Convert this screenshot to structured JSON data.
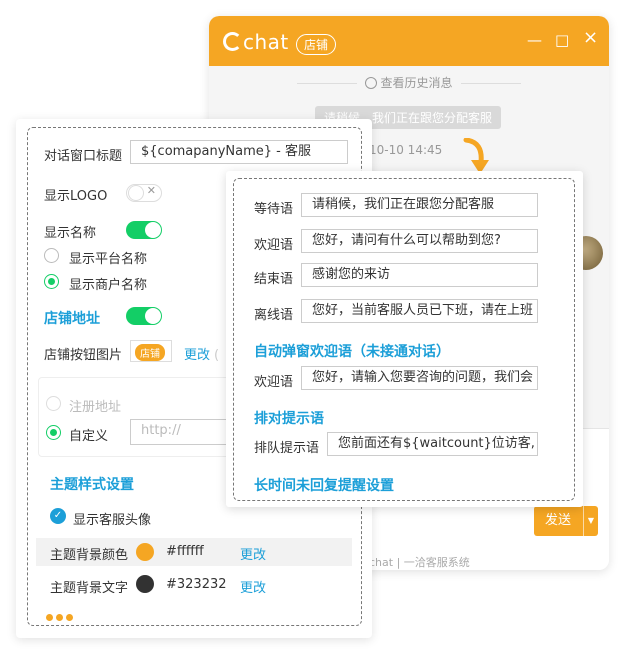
{
  "chat_window": {
    "logo": "chat",
    "badge": "店铺",
    "controls": [
      "×",
      "□",
      "—"
    ],
    "history_link": "查看历史消息",
    "system_message": "请稍候，我们正在跟您分配客服",
    "timestamp": "10-10 14:45",
    "send_label": "发送",
    "send_arrow": "▼",
    "footer_brand": "chat | 一洽客服系统"
  },
  "settings": {
    "title_label": "对话窗口标题",
    "title_value": "${comapanyName} - 客服",
    "logo_label": "显示LOGO",
    "name_label": "显示名称",
    "platform_name": "显示平台名称",
    "merchant_name": "显示商户名称",
    "shop_address": "店铺地址",
    "shop_button_label": "店铺按钮图片",
    "shop_button_img": "店铺",
    "change": "更改",
    "change_suffix": "(",
    "registered_address": "注册地址",
    "custom": "自定义",
    "url_placeholder": "http://",
    "theme_title": "主题样式设置",
    "show_avatar": "显示客服头像",
    "bg_color_label": "主题背景颜色",
    "bg_color_value": "#ffffff",
    "text_color_label": "主题背景文字",
    "text_color_value": "#323232"
  },
  "messages": {
    "waiting_label": "等待语",
    "waiting_value": "请稍候，我们正在跟您分配客服",
    "welcome_label": "欢迎语",
    "welcome_value": "您好，请问有什么可以帮助到您?",
    "end_label": "结束语",
    "end_value": "感谢您的来访",
    "offline_label": "离线语",
    "offline_value": "您好，当前客服人员已下班，请在上班",
    "popup_title": "自动弹窗欢迎语（未接通对话）",
    "popup_welcome_label": "欢迎语",
    "popup_welcome_value": "您好，请输入您要咨询的问题，我们会",
    "queue_title": "排对提示语",
    "queue_label": "排队提示语",
    "queue_value": "您前面还有${waitcount}位访客,",
    "reminder_title": "长时间未回复提醒设置"
  },
  "colors": {
    "accent": "#f5a623",
    "link": "#1c9fd8",
    "toggle_on": "#13ce66",
    "bg_swatch": "#f5a623",
    "text_swatch": "#323232"
  }
}
